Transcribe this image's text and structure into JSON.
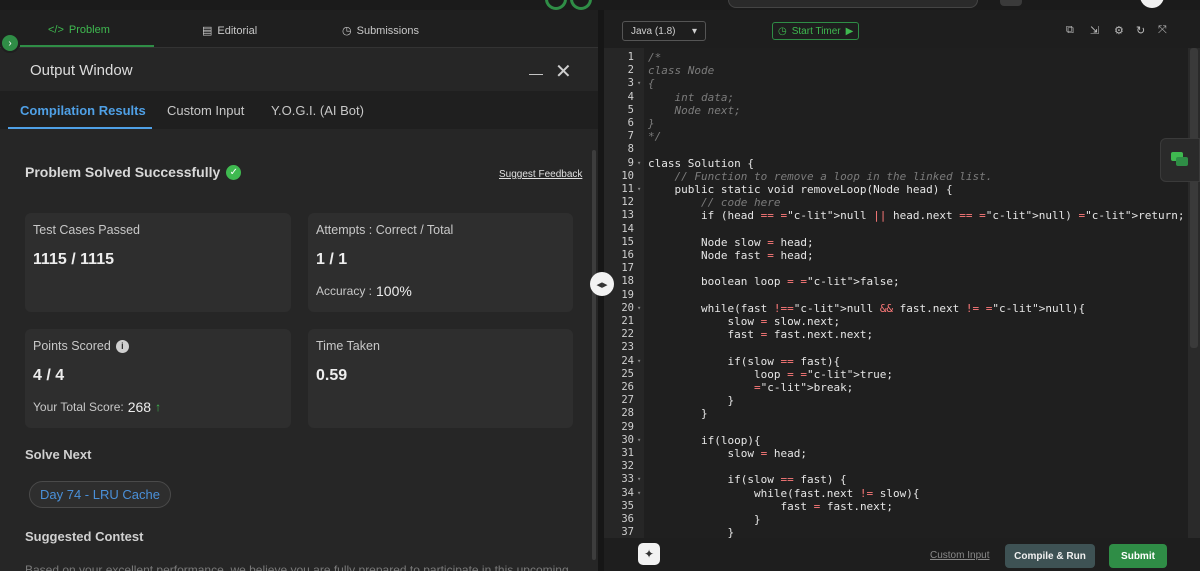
{
  "tabs": [
    {
      "label": "Problem",
      "icon": "code-icon"
    },
    {
      "label": "Editorial",
      "icon": "document-icon"
    },
    {
      "label": "Submissions",
      "icon": "clock-icon"
    }
  ],
  "output_window": {
    "title": "Output Window",
    "tabs": [
      "Compilation Results",
      "Custom Input",
      "Y.O.G.I. (AI Bot)"
    ]
  },
  "result": {
    "status": "Problem Solved Successfully",
    "feedback_link": "Suggest Feedback",
    "test_cases_label": "Test Cases Passed",
    "test_cases_value": "1115 / 1115",
    "attempts_label": "Attempts : Correct / Total",
    "attempts_value": "1 / 1",
    "accuracy_label": "Accuracy :",
    "accuracy_value": "100%",
    "points_label": "Points Scored",
    "points_value": "4 / 4",
    "total_score_label": "Your Total Score:",
    "total_score_value": "268",
    "time_label": "Time Taken",
    "time_value": "0.59"
  },
  "solve_next": {
    "heading": "Solve Next",
    "item": "Day 74 - LRU Cache"
  },
  "suggested_contest": {
    "heading": "Suggested Contest",
    "text": "Based on your excellent performance, we believe you are fully prepared to participate in this upcoming"
  },
  "editor": {
    "language": "Java (1.8)",
    "timer_label": "Start Timer",
    "lines": [
      "/*",
      "class Node",
      "{",
      "    int data;",
      "    Node next;",
      "}",
      "*/",
      "",
      "class Solution {",
      "    // Function to remove a loop in the linked list.",
      "    public static void removeLoop(Node head) {",
      "        // code here",
      "        if (head == null || head.next == null) return;",
      "",
      "        Node slow = head;",
      "        Node fast = head;",
      "",
      "        boolean loop = false;",
      "",
      "        while(fast !=null && fast.next != null){",
      "            slow = slow.next;",
      "            fast = fast.next.next;",
      "",
      "            if(slow == fast){",
      "                loop = true;",
      "                break;",
      "            }",
      "        }",
      "",
      "        if(loop){",
      "            slow = head;",
      "",
      "            if(slow == fast) {",
      "                while(fast.next != slow){",
      "                    fast = fast.next;",
      "                }",
      "            }"
    ]
  },
  "bottom": {
    "custom_input": "Custom Input",
    "compile_run": "Compile & Run",
    "submit": "Submit"
  },
  "colors": {
    "accent_green": "#2f8d46",
    "link_blue": "#4fa0e6",
    "keyword_red": "#ff7a7a"
  }
}
